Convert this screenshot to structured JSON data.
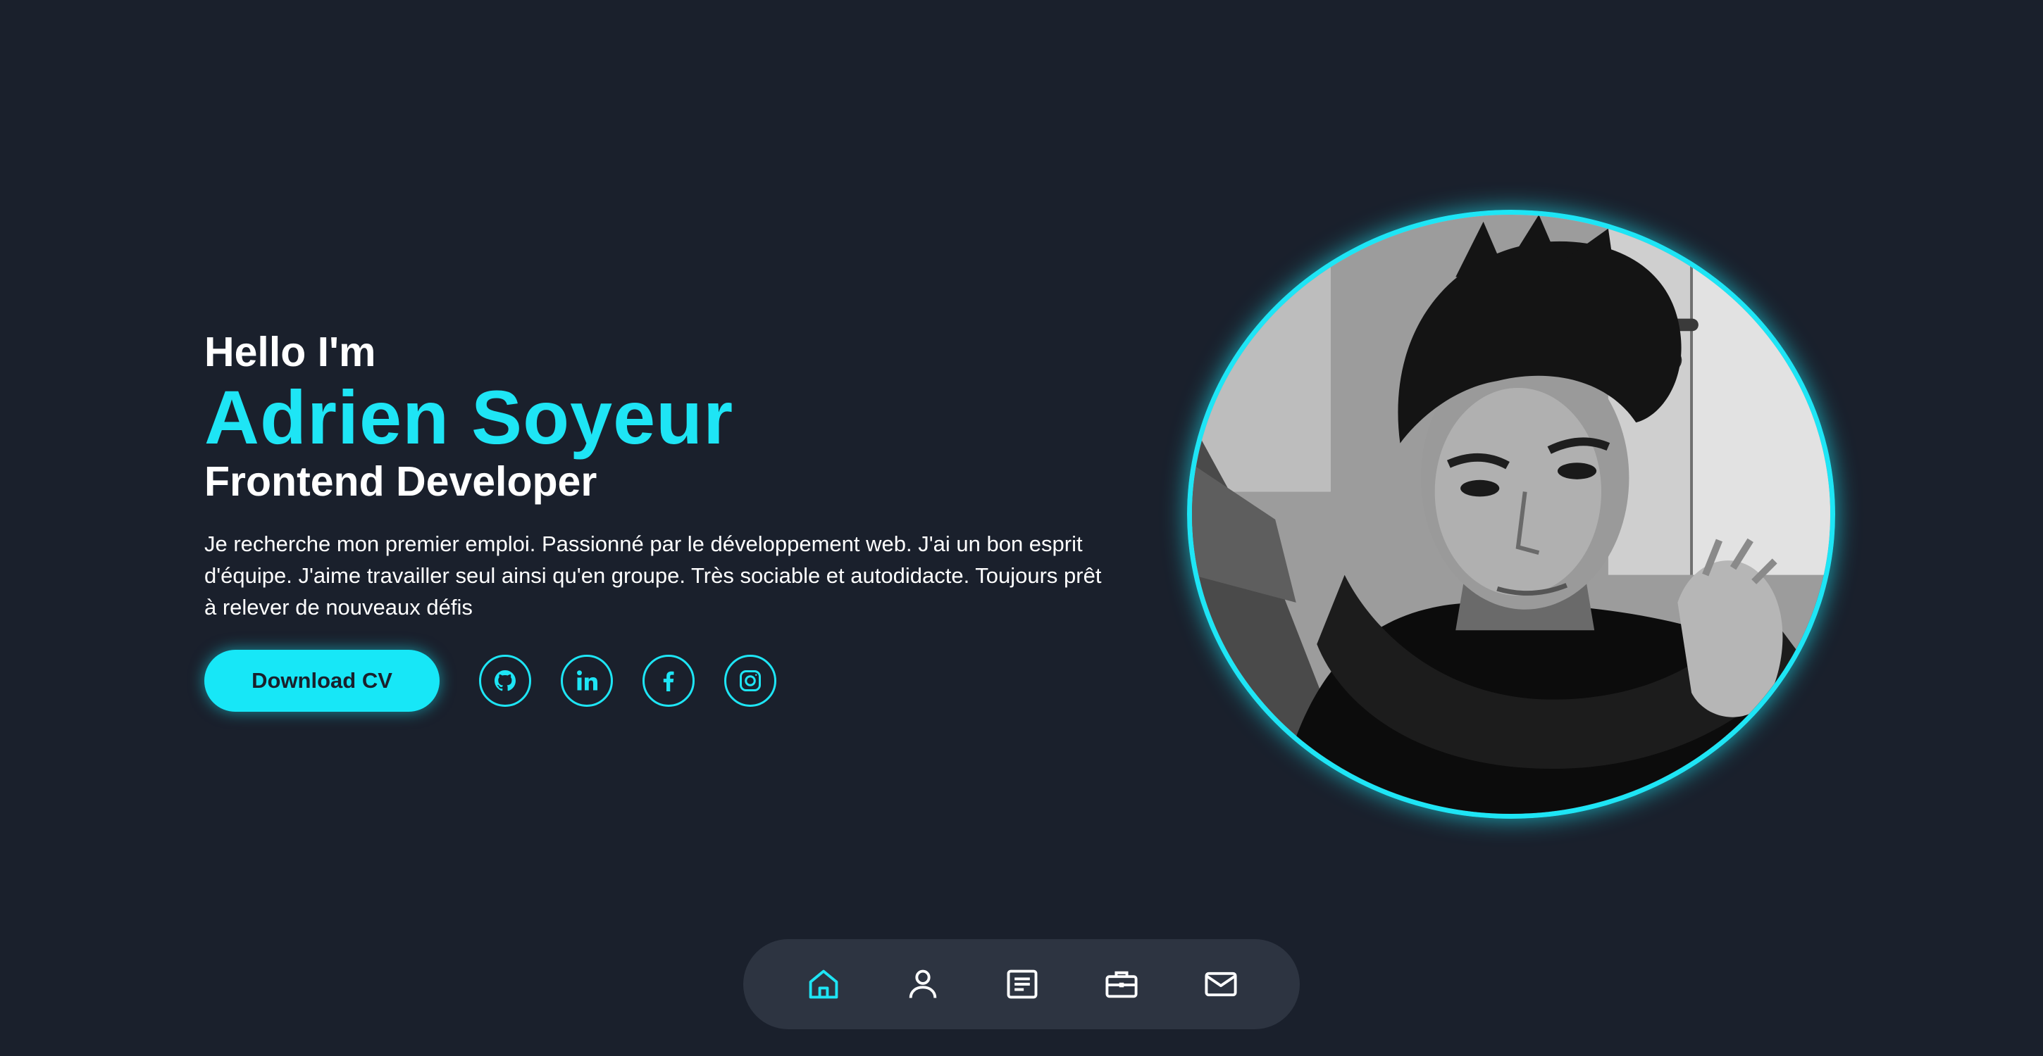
{
  "hero": {
    "greeting": "Hello I'm",
    "name": "Adrien Soyeur",
    "role": "Frontend Developer",
    "bio": "Je recherche mon premier emploi. Passionné par le développement web. J'ai un bon esprit d'équipe. J'aime travailler seul ainsi qu'en groupe. Très sociable et autodidacte. Toujours prêt à relever de nouveaux défis",
    "cv_label": "Download CV"
  },
  "social": [
    {
      "icon": "github-icon"
    },
    {
      "icon": "linkedin-icon"
    },
    {
      "icon": "facebook-icon"
    },
    {
      "icon": "instagram-icon"
    }
  ],
  "nav": {
    "items": [
      {
        "icon": "home-icon",
        "active": true
      },
      {
        "icon": "user-icon",
        "active": false
      },
      {
        "icon": "document-icon",
        "active": false
      },
      {
        "icon": "briefcase-icon",
        "active": false
      },
      {
        "icon": "mail-icon",
        "active": false
      }
    ]
  },
  "colors": {
    "background": "#1a202c",
    "accent": "#1ee5f5",
    "nav_background": "#2d3441",
    "text": "#ffffff"
  }
}
